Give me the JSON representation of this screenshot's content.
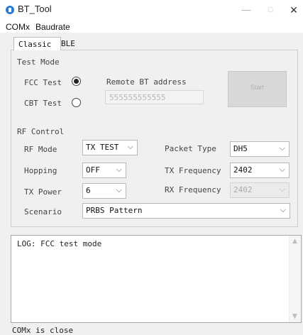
{
  "window": {
    "title": "BT_Tool",
    "minimize": "—",
    "maximize": "☐",
    "close": "✕"
  },
  "menu": [
    "COMx",
    "Baudrate"
  ],
  "tabs": [
    "Classic",
    "BLE"
  ],
  "test_mode": {
    "section_label": "Test Mode",
    "fcc_label": "FCC Test",
    "cbt_label": "CBT Test",
    "fcc_selected": true,
    "remote_label": "Remote BT address",
    "remote_value": "555555555555",
    "start_label": "Start"
  },
  "rf_control": {
    "section_label": "RF Control",
    "rf_mode_label": "RF Mode",
    "rf_mode_value": "TX TEST",
    "hopping_label": "Hopping",
    "hopping_value": "OFF",
    "tx_power_label": "TX Power",
    "tx_power_value": "6",
    "scenario_label": "Scenario",
    "scenario_value": "PRBS Pattern",
    "packet_type_label": "Packet Type",
    "packet_type_value": "DH5",
    "tx_freq_label": "TX Frequency",
    "tx_freq_value": "2402",
    "rx_freq_label": "RX Frequency",
    "rx_freq_value": "2402"
  },
  "log": {
    "text": "LOG: FCC test mode"
  },
  "status": {
    "text": "COMx is close"
  },
  "icons": {
    "app": "bluetooth-app-icon",
    "chevron": "chevron-down-icon"
  },
  "colors": {
    "app_icon": "#2a7bd3",
    "window_bg": "#f0f0f0",
    "start_button_disabled": "#d8d8d8"
  }
}
